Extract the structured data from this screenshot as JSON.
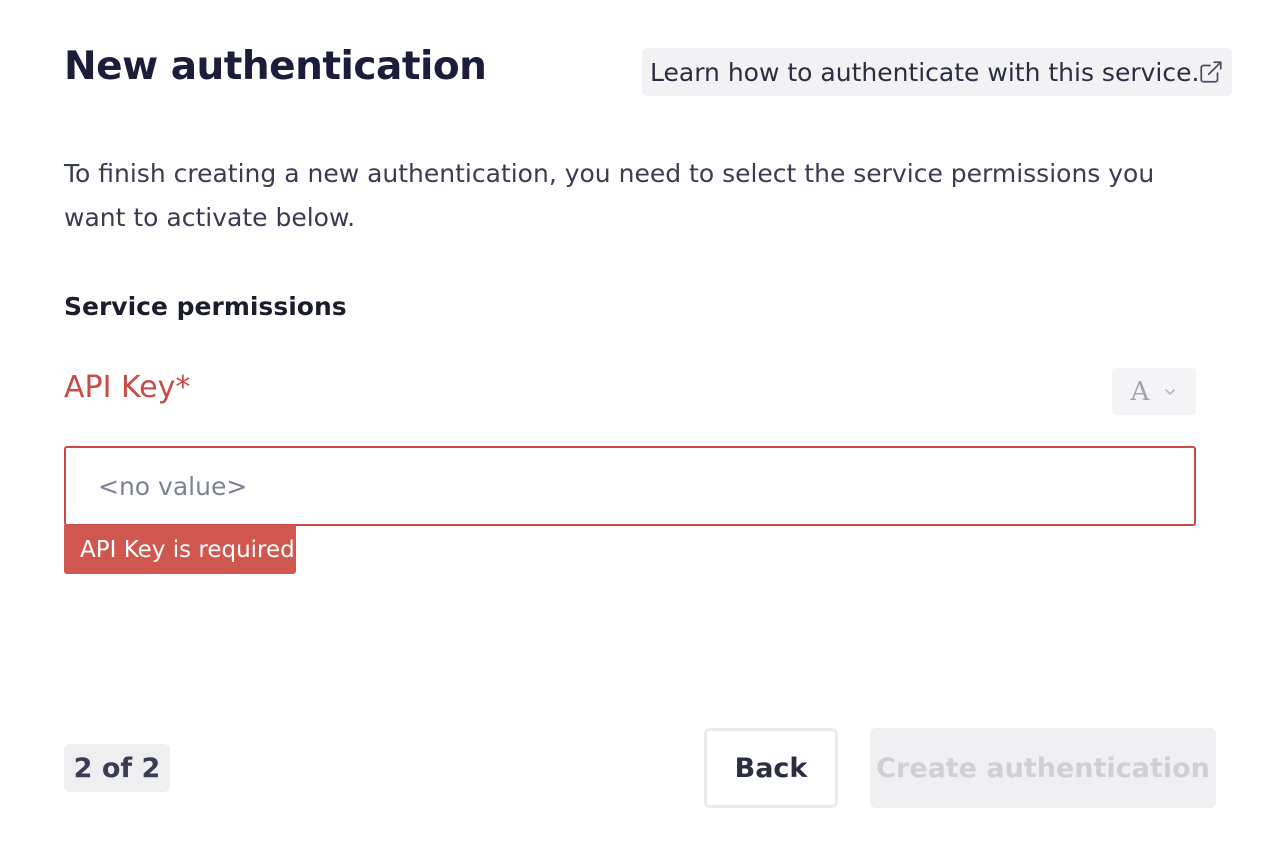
{
  "dialog": {
    "title": "New authentication",
    "help_link_label": "Learn how to authenticate with this service.",
    "help_link_icon": "external-link-icon",
    "description": "To finish creating a new authentication, you need to select the service permissions you want to activate below.",
    "section_title": "Service permissions"
  },
  "field": {
    "label": "API Key*",
    "type_selector_value": "A",
    "placeholder": "<no value>",
    "value": "",
    "error": "API Key is required"
  },
  "footer": {
    "step_indicator": "2 of 2",
    "back_label": "Back",
    "create_label": "Create authentication",
    "create_disabled": true
  },
  "colors": {
    "error": "#c94a46",
    "error_badge": "#d0574f",
    "title": "#1b1d3a"
  }
}
